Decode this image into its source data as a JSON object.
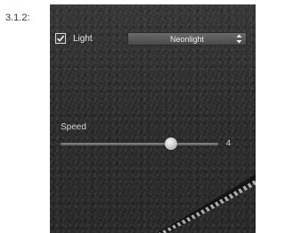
{
  "step_label": "3.1.2:",
  "light": {
    "label": "Light",
    "checked": true
  },
  "mode_select": {
    "value": "Neonlight",
    "icon": "updown-arrows-icon"
  },
  "speed": {
    "label": "Speed",
    "value_text": "4",
    "fraction": 0.7
  },
  "colors": {
    "panel_bg": "#2d2d2d",
    "text": "#e4e4e4"
  }
}
